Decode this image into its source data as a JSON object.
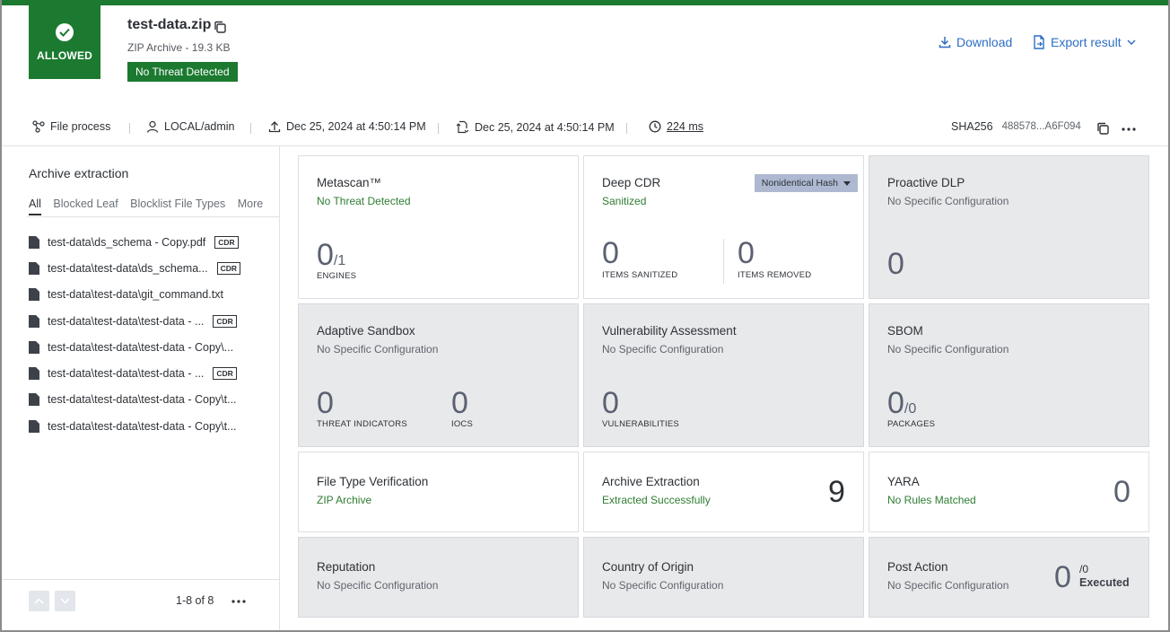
{
  "header": {
    "status_label": "ALLOWED",
    "file_name": "test-data.zip",
    "file_info": "ZIP Archive - 19.3 KB",
    "verdict": "No Threat Detected",
    "download_label": "Download",
    "export_label": "Export result"
  },
  "meta": {
    "process": "File process",
    "user": "LOCAL/admin",
    "uploaded": "Dec 25, 2024 at 4:50:14 PM",
    "processed": "Dec 25, 2024 at 4:50:14 PM",
    "duration": "224 ms",
    "hash_label": "SHA256",
    "hash_value": "488578...A6F094"
  },
  "sidebar": {
    "title": "Archive extraction",
    "tabs": [
      "All",
      "Blocked Leaf",
      "Blocklist File Types",
      "More"
    ],
    "files": [
      {
        "name": "test-data\\ds_schema - Copy.pdf",
        "cdr": "CDR"
      },
      {
        "name": "test-data\\test-data\\ds_schema...",
        "cdr": "CDR"
      },
      {
        "name": "test-data\\test-data\\git_command.txt",
        "cdr": ""
      },
      {
        "name": "test-data\\test-data\\test-data - ...",
        "cdr": "CDR"
      },
      {
        "name": "test-data\\test-data\\test-data - Copy\\...",
        "cdr": ""
      },
      {
        "name": "test-data\\test-data\\test-data - ...",
        "cdr": "CDR"
      },
      {
        "name": "test-data\\test-data\\test-data - Copy\\t...",
        "cdr": ""
      },
      {
        "name": "test-data\\test-data\\test-data - Copy\\t...",
        "cdr": ""
      }
    ],
    "pagination": "1-8 of 8"
  },
  "cards": {
    "metascan": {
      "title": "Metascan™",
      "status": "No Threat Detected",
      "value": "0",
      "denominator": "/1",
      "caption": "ENGINES"
    },
    "deep_cdr": {
      "title": "Deep CDR",
      "status": "Sanitized",
      "dropdown": "Nonidentical Hash",
      "sanitized": "0",
      "sanitized_caption": "ITEMS SANITIZED",
      "removed": "0",
      "removed_caption": "ITEMS REMOVED"
    },
    "dlp": {
      "title": "Proactive DLP",
      "status": "No Specific Configuration",
      "value": "0"
    },
    "sandbox": {
      "title": "Adaptive Sandbox",
      "status": "No Specific Configuration",
      "threat": "0",
      "threat_caption": "THREAT INDICATORS",
      "iocs": "0",
      "iocs_caption": "IOCS"
    },
    "vuln": {
      "title": "Vulnerability Assessment",
      "status": "No Specific Configuration",
      "value": "0",
      "caption": "VULNERABILITIES"
    },
    "sbom": {
      "title": "SBOM",
      "status": "No Specific Configuration",
      "value": "0",
      "denominator": "/0",
      "caption": "PACKAGES"
    },
    "ftv": {
      "title": "File Type Verification",
      "status": "ZIP Archive"
    },
    "archive": {
      "title": "Archive Extraction",
      "status": "Extracted Successfully",
      "value": "9"
    },
    "yara": {
      "title": "YARA",
      "status": "No Rules Matched",
      "value": "0"
    },
    "reputation": {
      "title": "Reputation",
      "status": "No Specific Configuration"
    },
    "country": {
      "title": "Country of Origin",
      "status": "No Specific Configuration"
    },
    "post": {
      "title": "Post Action",
      "status": "No Specific Configuration",
      "value": "0",
      "denominator": "/0",
      "executed": "Executed"
    }
  },
  "colors": {
    "brand_green": "#1b7a2f",
    "link_blue": "#2d6fc2",
    "grey_card": "#e8e9eb"
  }
}
